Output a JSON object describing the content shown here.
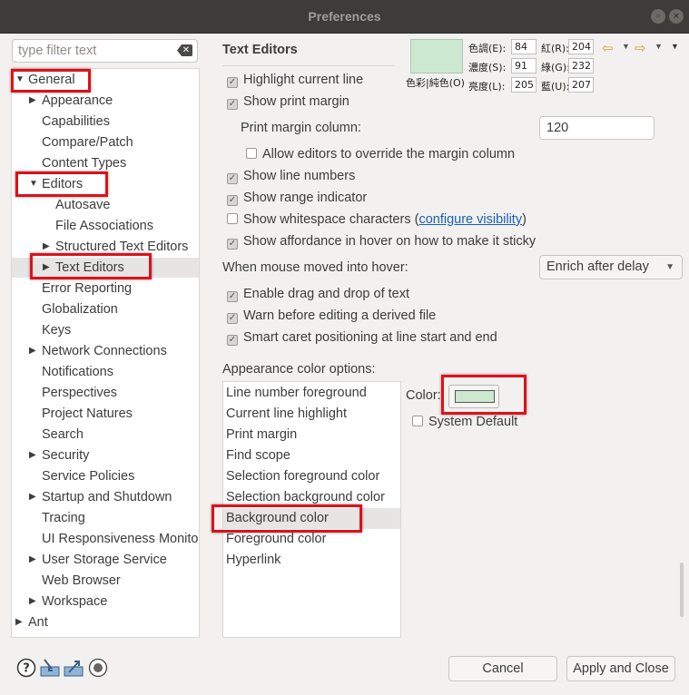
{
  "window": {
    "title": "Preferences"
  },
  "filter": {
    "placeholder": "type filter text"
  },
  "tree": {
    "items": [
      {
        "label": "General",
        "indent": 0,
        "expanded": true
      },
      {
        "label": "Appearance",
        "indent": 1,
        "collapsed": true
      },
      {
        "label": "Capabilities",
        "indent": 1
      },
      {
        "label": "Compare/Patch",
        "indent": 1
      },
      {
        "label": "Content Types",
        "indent": 1
      },
      {
        "label": "Editors",
        "indent": 1,
        "expanded": true
      },
      {
        "label": "Autosave",
        "indent": 2
      },
      {
        "label": "File Associations",
        "indent": 2
      },
      {
        "label": "Structured Text Editors",
        "indent": 2,
        "collapsed": true
      },
      {
        "label": "Text Editors",
        "indent": 2,
        "collapsed": true,
        "selected": true
      },
      {
        "label": "Error Reporting",
        "indent": 1
      },
      {
        "label": "Globalization",
        "indent": 1
      },
      {
        "label": "Keys",
        "indent": 1
      },
      {
        "label": "Network Connections",
        "indent": 1,
        "collapsed": true
      },
      {
        "label": "Notifications",
        "indent": 1
      },
      {
        "label": "Perspectives",
        "indent": 1
      },
      {
        "label": "Project Natures",
        "indent": 1
      },
      {
        "label": "Search",
        "indent": 1
      },
      {
        "label": "Security",
        "indent": 1,
        "collapsed": true
      },
      {
        "label": "Service Policies",
        "indent": 1
      },
      {
        "label": "Startup and Shutdown",
        "indent": 1,
        "collapsed": true
      },
      {
        "label": "Tracing",
        "indent": 1
      },
      {
        "label": "UI Responsiveness Monito",
        "indent": 1
      },
      {
        "label": "User Storage Service",
        "indent": 1,
        "collapsed": true
      },
      {
        "label": "Web Browser",
        "indent": 1
      },
      {
        "label": "Workspace",
        "indent": 1,
        "collapsed": true
      },
      {
        "label": "Ant",
        "indent": 0,
        "collapsed": true
      }
    ]
  },
  "page": {
    "title": "Text Editors",
    "highlight_current_line": "Highlight current line",
    "show_print_margin": "Show print margin",
    "print_margin_column_label": "Print margin column:",
    "print_margin_column_value": "120",
    "allow_override": "Allow editors to override the margin column",
    "show_line_numbers": "Show line numbers",
    "show_range_indicator": "Show range indicator",
    "show_whitespace": "Show whitespace characters",
    "configure_visibility_open": "(",
    "configure_visibility": "configure visibility",
    "configure_visibility_close": ")",
    "show_affordance": "Show affordance in hover on how to make it sticky",
    "hover_label": "When mouse moved into hover:",
    "hover_value": "Enrich after delay",
    "drag_drop": "Enable drag and drop of text",
    "warn_derived": "Warn before editing a derived file",
    "smart_caret": "Smart caret positioning at line start and end",
    "appearance_label": "Appearance color options:",
    "color_label": "Color:",
    "system_default": "System Default",
    "appearance_items": [
      "Line number foreground",
      "Current line highlight",
      "Print margin",
      "Find scope",
      "Selection foreground color",
      "Selection background color",
      "Background color",
      "Foreground color",
      "Hyperlink"
    ],
    "selected_color": "#cce8cf"
  },
  "picker": {
    "hue_label": "色調(E):",
    "hue": "84",
    "sat_label": "濃度(S):",
    "sat": "91",
    "lum_label": "亮度(L):",
    "lum": "205",
    "red_label": "紅(R):",
    "red": "204",
    "green_label": "綠(G):",
    "green": "232",
    "blue_label": "藍(U):",
    "blue": "207",
    "solid_label": "色彩|純色(O)"
  },
  "buttons": {
    "cancel": "Cancel",
    "apply_close": "Apply and Close"
  },
  "colors": {
    "highlight": "#e0101a",
    "swatch": "#cce8cf",
    "link": "#1a5fb4"
  }
}
